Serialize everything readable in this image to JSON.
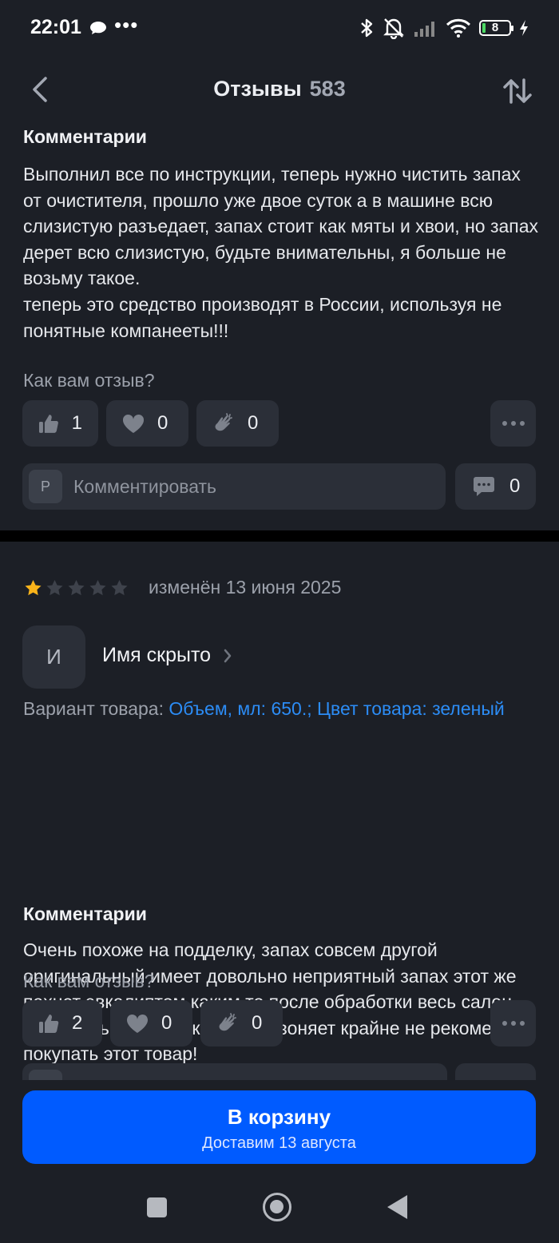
{
  "status": {
    "time": "22:01",
    "dots": "•••",
    "battery": "8",
    "battery_level": 0.08
  },
  "header": {
    "title": "Отзывы",
    "count": "583"
  },
  "review1": {
    "section_title": "Комментарии",
    "text": "Выполнил все по инструкции, теперь нужно чистить запах от очистителя, прошло уже двое суток а в машине всю слизистую разъедает, запах стоит как мяты и хвои, но запах дерет всю слизистую, будьте внимательны,  я больше не возьму такое.\nтеперь это средство производят в России, используя не понятные компанееты!!!",
    "rate_question": "Как вам отзыв?",
    "likes": "1",
    "hearts": "0",
    "claps": "0",
    "comment_avatar": "Р",
    "comment_placeholder": "Комментировать",
    "comments": "0"
  },
  "review2": {
    "rating": 1,
    "date": "изменён 13 июня 2025",
    "avatar": "И",
    "author": "Имя скрыто",
    "variant_label": "Вариант товара: ",
    "variant_value": "Объем, мл: 650.; Цвет товара: зеленый",
    "section_title": "Комментарии",
    "text": "Очень похоже на подделку, запах совсем другой оригинальный имеет довольно неприятный запах этот же пахнет эвкалиптом каким то после обработки весь салон этим дерьмовым эвкалиптом воняет крайне не рекомендую покупать этот товар!",
    "rate_question": "Как вам отзыв?",
    "likes": "2",
    "hearts": "0",
    "claps": "0"
  },
  "cart": {
    "title": "В корзину",
    "subtitle": "Доставим 13 августа"
  },
  "colors": {
    "accent": "#005bff",
    "link": "#2c8cf5",
    "star_filled": "#f9b31a",
    "star_empty": "#3e424b",
    "background": "#1c1f26"
  }
}
